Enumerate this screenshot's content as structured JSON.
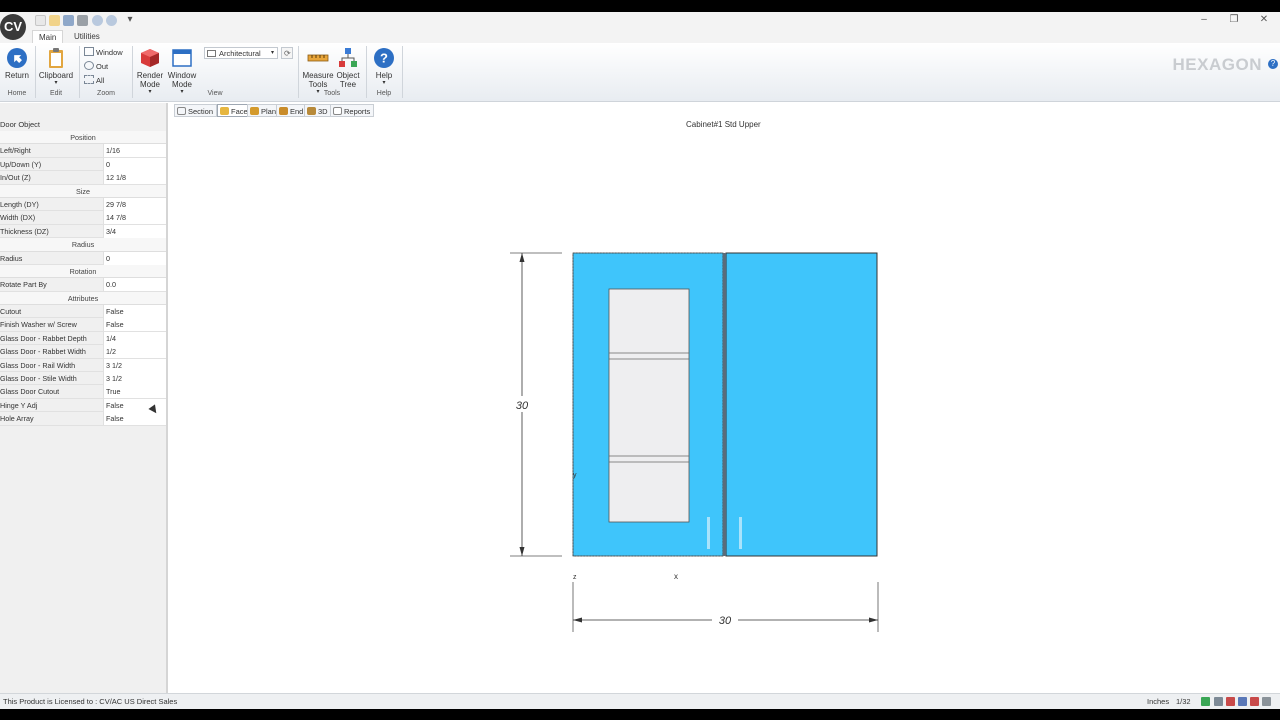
{
  "app": {
    "logo": "CV",
    "brand": "HEXAGON"
  },
  "ribbon": {
    "tabs": [
      {
        "label": "Main"
      },
      {
        "label": "Utilities"
      }
    ],
    "buttons": {
      "return": "Return",
      "clipboard": "Clipboard",
      "render_mode": "Render Mode",
      "window_mode": "Window Mode",
      "measure_tools": "Measure Tools",
      "object_tree": "Object Tree",
      "help": "Help"
    },
    "zoom_items": {
      "window": "Window",
      "out": "Out",
      "all": "All"
    },
    "view_select": "Architectural",
    "groups": {
      "home": "Home",
      "edit": "Edit",
      "zoom": "Zoom",
      "view": "View",
      "tools": "Tools",
      "help": "Help"
    }
  },
  "panel": {
    "title": "Door Object",
    "categories": {
      "position": "Position",
      "size": "Size",
      "radius": "Radius",
      "rotation": "Rotation",
      "attributes": "Attributes"
    },
    "position": [
      {
        "key": "Left/Right",
        "value": "1/16"
      },
      {
        "key": "Up/Down (Y)",
        "value": "0"
      },
      {
        "key": "In/Out (Z)",
        "value": "12 1/8"
      }
    ],
    "size": [
      {
        "key": "Length (DY)",
        "value": "29 7/8"
      },
      {
        "key": "Width (DX)",
        "value": "14 7/8"
      },
      {
        "key": "Thickness (DZ)",
        "value": "3/4"
      }
    ],
    "radius": [
      {
        "key": "Radius",
        "value": "0"
      }
    ],
    "rotation": [
      {
        "key": "Rotate Part By",
        "value": "0.0"
      }
    ],
    "attributes": [
      {
        "key": "Cutout",
        "value": "False"
      },
      {
        "key": "Finish Washer w/ Screw",
        "value": "False"
      },
      {
        "key": "Glass Door - Rabbet Depth",
        "value": "1/4"
      },
      {
        "key": "Glass Door - Rabbet Width",
        "value": "1/2"
      },
      {
        "key": "Glass Door - Rail Width",
        "value": "3 1/2"
      },
      {
        "key": "Glass Door - Stile Width",
        "value": "3 1/2"
      },
      {
        "key": "Glass Door Cutout",
        "value": "True"
      },
      {
        "key": "Hinge Y Adj",
        "value": "False"
      },
      {
        "key": "Hole Array",
        "value": "False"
      }
    ]
  },
  "view_tabs": [
    {
      "label": "Section"
    },
    {
      "label": "Face"
    },
    {
      "label": "Plan"
    },
    {
      "label": "End"
    },
    {
      "label": "3D"
    },
    {
      "label": "Reports"
    }
  ],
  "drawing": {
    "title": "Cabinet#1 Std Upper",
    "height_dim": "30",
    "width_dim": "30",
    "axis_x": "x",
    "axis_y": "y",
    "axis_z": "z"
  },
  "status": {
    "license": "This Product is Licensed to : CV/AC US Direct Sales",
    "units": "Inches",
    "precision": "1/32"
  },
  "colors": {
    "door": "#3fc5fb",
    "glass": "#eeeef0",
    "accent": "#2d6fc4"
  }
}
